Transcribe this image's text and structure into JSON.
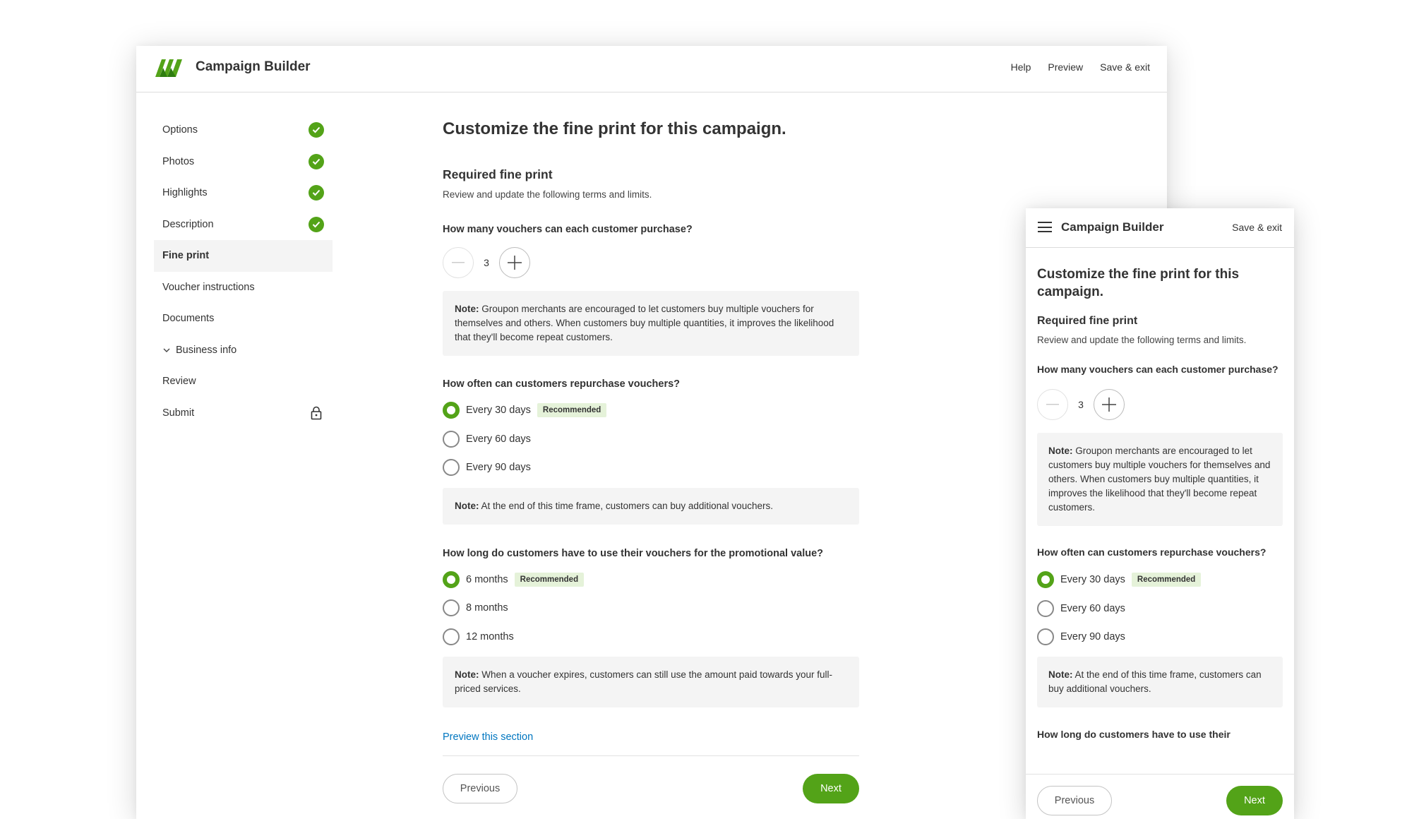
{
  "app": {
    "title": "Campaign Builder",
    "nav": {
      "help": "Help",
      "preview": "Preview",
      "save_exit": "Save & exit"
    }
  },
  "sidebar": {
    "items": [
      {
        "label": "Options",
        "status": "complete"
      },
      {
        "label": "Photos",
        "status": "complete"
      },
      {
        "label": "Highlights",
        "status": "complete"
      },
      {
        "label": "Description",
        "status": "complete"
      },
      {
        "label": "Fine print",
        "status": "active"
      },
      {
        "label": "Voucher instructions",
        "status": "none"
      },
      {
        "label": "Documents",
        "status": "none"
      },
      {
        "label": "Business info",
        "status": "collapsible"
      },
      {
        "label": "Review",
        "status": "none"
      },
      {
        "label": "Submit",
        "status": "locked"
      }
    ]
  },
  "page": {
    "title": "Customize the fine print for this campaign.",
    "section_title": "Required fine print",
    "section_subtitle": "Review and update the following terms and limits.",
    "q1": {
      "label": "How many vouchers can each customer purchase?",
      "value": "3",
      "note_bold": "Note:",
      "note": " Groupon merchants are encouraged to let customers buy multiple vouchers for themselves and others. When customers buy multiple quantities, it improves the likelihood that they'll become repeat customers."
    },
    "q2": {
      "label": "How often can customers repurchase vouchers?",
      "options": [
        "Every 30 days",
        "Every 60 days",
        "Every 90 days"
      ],
      "selected_index": 0,
      "badge": "Recommended",
      "note_bold": "Note:",
      "note": " At the end of this time frame, customers can buy additional vouchers."
    },
    "q3": {
      "label": "How long do customers have to use their vouchers for the promotional value?",
      "options": [
        "6 months",
        "8 months",
        "12 months"
      ],
      "selected_index": 0,
      "badge": "Recommended",
      "note_bold": "Note:",
      "note": " When a voucher expires, customers can still use the amount paid towards your full-priced services."
    },
    "preview_link": "Preview this section",
    "prev_label": "Previous",
    "next_label": "Next"
  },
  "mobile": {
    "title": "Campaign Builder",
    "save_exit": "Save & exit",
    "q3_partial": "How long do customers have to use their"
  },
  "colors": {
    "brand_green": "#53a318",
    "link_blue": "#0076c0",
    "badge_bg": "#e5f2d9",
    "note_bg": "#f4f4f4"
  }
}
